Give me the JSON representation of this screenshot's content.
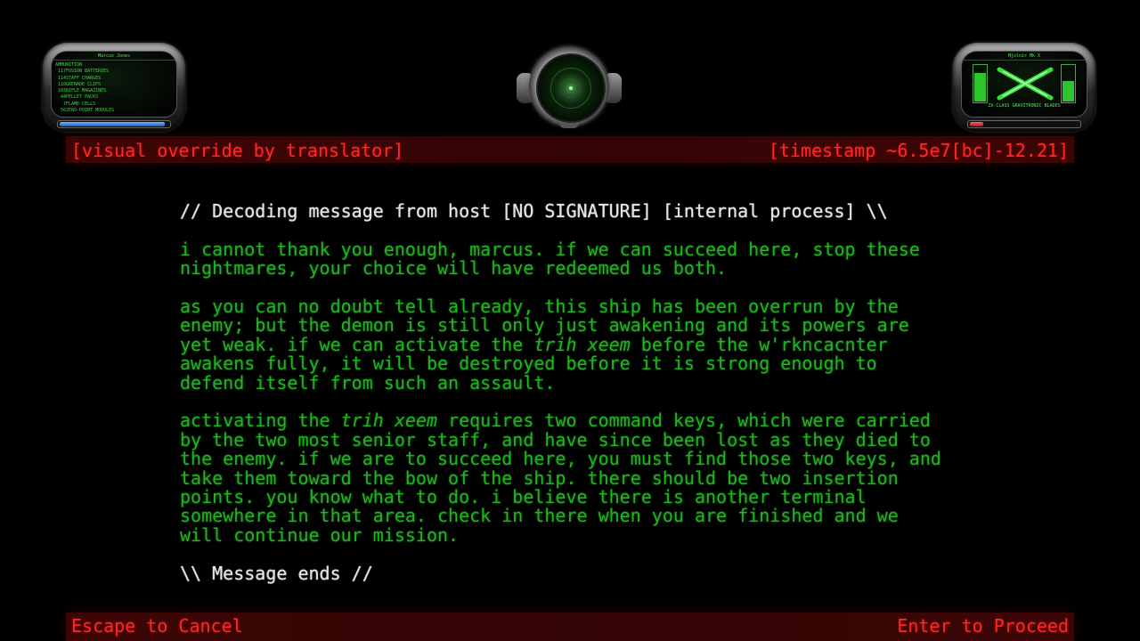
{
  "hud": {
    "left_pod": {
      "player_name": "Marcus Jones",
      "ammo_heading": "AMMUNITION",
      "ammo": [
        {
          "count": "117",
          "label": "FUSION BATTERIES"
        },
        {
          "count": "114",
          "label": "STAFF CHARGES"
        },
        {
          "count": "110",
          "label": "GRENADE CLIPS"
        },
        {
          "count": "103",
          "label": "RIFLE MAGAZINES"
        },
        {
          "count": "44",
          "label": "PELLET PACKS"
        },
        {
          "count": "7",
          "label": "FLAME CELLS"
        },
        {
          "count": "56",
          "label": "ZERO-POINT MODULES"
        }
      ],
      "shield_level": 0.97
    },
    "right_pod": {
      "armor_name": "Mjolnir Mk X",
      "weapon_name": "ZX-CLASS GRAVITRONIC BLADES",
      "left_gauge_level": 0.8,
      "right_gauge_level": 0.6,
      "health_level": 0.15
    },
    "colors": {
      "hud_green": "#3fd43f",
      "bar_red": "#ff2828",
      "message_green": "#22b322"
    }
  },
  "header": {
    "left": "[visual override by translator]",
    "right": "[timestamp ~6.5e7[bc]-12.21]"
  },
  "message": {
    "header_line": "// Decoding message from host [NO SIGNATURE] [internal process] \\\\",
    "paragraphs": [
      [
        {
          "t": "i cannot thank you enough, marcus. if we can succeed here, stop these\nnightmares, your choice will have redeemed us both."
        }
      ],
      [
        {
          "t": "as you can no doubt tell already, this ship has been overrun by the\nenemy; but the demon is still only just awakening and its powers are\nyet weak. if we can activate the "
        },
        {
          "t": "trih xeem",
          "em": true
        },
        {
          "t": " before the w'rkncacnter\nawakens fully, it will be destroyed before it is strong enough to\ndefend itself from such an assault."
        }
      ],
      [
        {
          "t": "activating the "
        },
        {
          "t": "trih xeem",
          "em": true
        },
        {
          "t": " requires two command keys, which were carried\nby the two most senior staff, and have since been lost as they died to\nthe enemy. if we are to succeed here, you must find those two keys, and\ntake them toward the bow of the ship. there should be two insertion\npoints. you know what to do. i believe there is another terminal\nsomewhere in that area. check in there when you are finished and we\nwill continue our mission."
        }
      ]
    ],
    "footer_line": "\\\\ Message ends //"
  },
  "footer": {
    "left": "Escape to Cancel",
    "right": "Enter to Proceed"
  }
}
